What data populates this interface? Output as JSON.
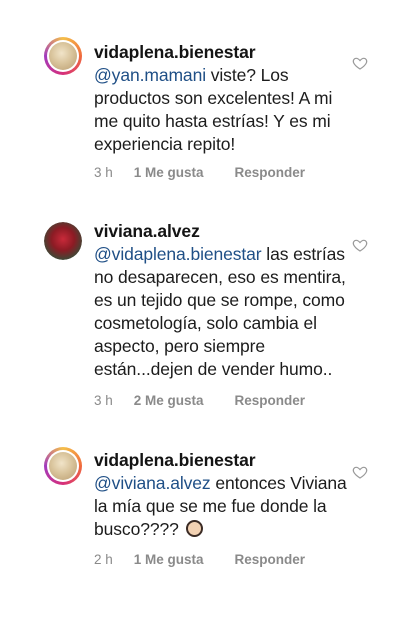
{
  "comments": [
    {
      "username": "vidaplena.bienestar",
      "mention": "@yan.mamani",
      "text": " viste? Los productos son excelentes! A mi me quito hasta estrías! Y es mi experiencia repito!",
      "time": "3 h",
      "likes": "1 Me gusta",
      "reply": "Responder",
      "liked": false
    },
    {
      "username": "viviana.alvez",
      "mention": "@vidaplena.bienestar",
      "text": " las estrías no desaparecen, eso es mentira, es un tejido que se rompe, como cosmetología, solo cambia el aspecto, pero siempre están...dejen de vender humo..",
      "time": "3 h",
      "likes": "2 Me gusta",
      "reply": "Responder",
      "liked": false
    },
    {
      "username": "vidaplena.bienestar",
      "mention": "@viviana.alvez",
      "text": " entonces Viviana la mía que se me fue donde la busco????",
      "emoji": "woman-facepalming-emoji",
      "time": "2 h",
      "likes": "1 Me gusta",
      "reply": "Responder",
      "liked": false
    }
  ],
  "colors": {
    "mention": "#1f4f86",
    "meta": "#8a8a8a",
    "heart": "#9a9a9a"
  }
}
